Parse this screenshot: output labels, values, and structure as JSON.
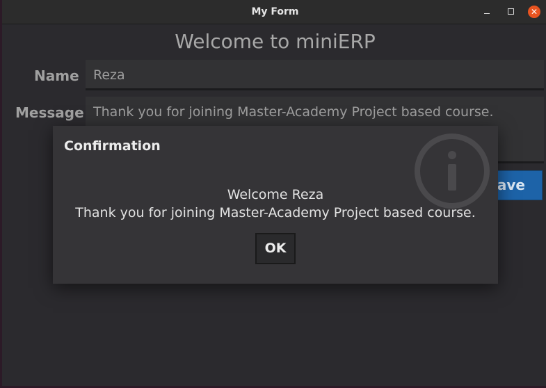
{
  "window": {
    "title": "My Form",
    "close_glyph": "✕"
  },
  "form": {
    "heading": "Welcome to miniERP",
    "name_label": "Name",
    "name_value": "Reza",
    "message_label": "Message",
    "message_value": "Thank you for joining Master-Academy Project based course.",
    "save_label": "Save",
    "save_visible_label": "Save"
  },
  "dialog": {
    "title": "Confirmation",
    "message_line1": "Welcome Reza",
    "message_line2": "Thank you for joining Master-Academy Project based course.",
    "ok_label": "OK",
    "icon": "info-icon"
  },
  "colors": {
    "accent": "#1d63a8",
    "close": "#e95420",
    "background": "#2b2a2e",
    "dialog": "#353437"
  }
}
